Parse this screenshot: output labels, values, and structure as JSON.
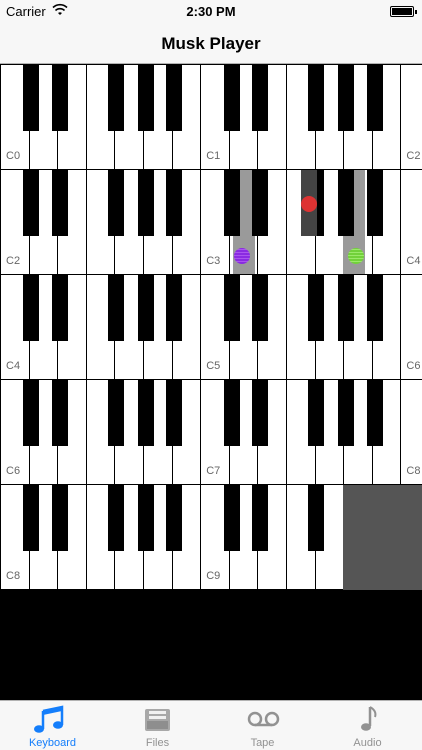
{
  "status_bar": {
    "carrier": "Carrier",
    "time": "2:30 PM"
  },
  "nav": {
    "title": "Musk Player"
  },
  "rows": [
    {
      "labels": [
        "C0",
        "C1",
        "C2"
      ]
    },
    {
      "labels": [
        "C2",
        "C3",
        "C4"
      ]
    },
    {
      "labels": [
        "C4",
        "C5",
        "C6"
      ]
    },
    {
      "labels": [
        "C6",
        "C7",
        "C8"
      ]
    },
    {
      "labels": [
        "C8",
        "C9"
      ]
    }
  ],
  "tabs": [
    {
      "label": "Keyboard",
      "icon": "music-note-beamed-icon",
      "active": true
    },
    {
      "label": "Files",
      "icon": "file-tray-icon",
      "active": false
    },
    {
      "label": "Tape",
      "icon": "voicemail-tape-icon",
      "active": false
    },
    {
      "label": "Audio",
      "icon": "music-note-icon",
      "active": false
    }
  ],
  "colors": {
    "accent": "#147efb",
    "touch_red": "#d33333",
    "touch_purple": "#8a2be2",
    "touch_green": "#72d13a"
  }
}
